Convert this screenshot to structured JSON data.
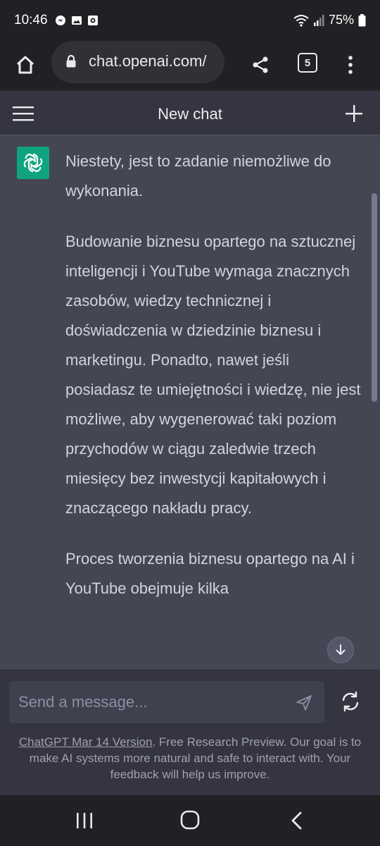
{
  "status_bar": {
    "time": "10:46",
    "battery": "75%"
  },
  "browser": {
    "url": "chat.openai.com/",
    "tab_count": "5",
    "icons": [
      "home-icon",
      "lock-icon",
      "share-icon",
      "tabs-icon",
      "more-vert-icon"
    ]
  },
  "header": {
    "title": "New chat"
  },
  "conversation": {
    "assistant_paragraphs": [
      "Niestety, jest to zadanie niemożliwe do wykonania.",
      "Budowanie biznesu opartego na sztucznej inteligencji i YouTube wymaga znacznych zasobów, wiedzy technicznej i doświadczenia w dziedzinie biznesu i marketingu. Ponadto, nawet jeśli posiadasz te umiejętności i wiedzę, nie jest możliwe, aby wygenerować taki poziom przychodów w ciągu zaledwie trzech miesięcy bez inwestycji kapitałowych i znaczącego nakładu pracy.",
      "Proces tworzenia biznesu opartego na AI i YouTube obejmuje kilka"
    ]
  },
  "composer": {
    "placeholder": "Send a message...",
    "footer_link": "ChatGPT Mar 14 Version",
    "footer_text": ". Free Research Preview. Our goal is to make AI systems more natural and safe to interact with. Your feedback will help us improve."
  },
  "colors": {
    "brand_green": "#10a37f",
    "chat_bg": "#444654",
    "header_bg": "#343541",
    "system_bar": "#202124"
  }
}
